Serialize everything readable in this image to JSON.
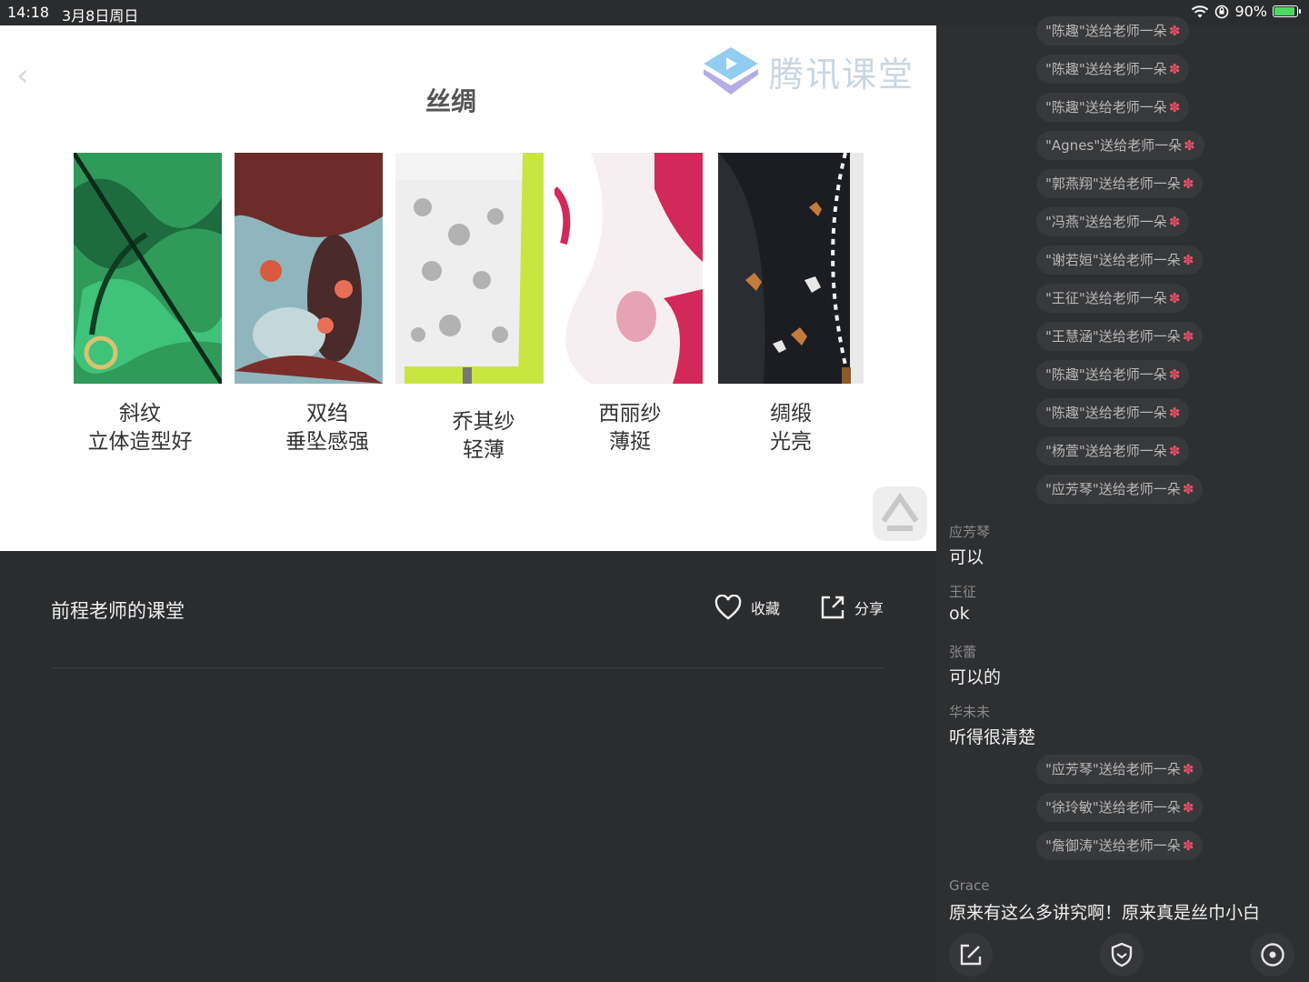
{
  "status_bar": {
    "time": "14:18",
    "date": "3月8日周日",
    "battery_percent": "90%",
    "battery_level": 0.9
  },
  "slide": {
    "title": "丝绸",
    "watermark": "腾讯课堂",
    "fabrics": [
      {
        "line1": "斜纹",
        "line2": "立体造型好"
      },
      {
        "line1": "双绉",
        "line2": "垂坠感强"
      },
      {
        "line1": "乔其纱",
        "line2": "轻薄"
      },
      {
        "line1": "西丽纱",
        "line2": "薄挺"
      },
      {
        "line1": "绸缎",
        "line2": "光亮"
      }
    ]
  },
  "course": {
    "title": "前程老师的课堂",
    "favorite_label": "收藏",
    "share_label": "分享"
  },
  "chat": {
    "gifts_top": [
      "\"陈趣\"送给老师一朵",
      "\"陈趣\"送给老师一朵",
      "\"陈趣\"送给老师一朵",
      "\"Agnes\"送给老师一朵",
      "\"郭燕翔\"送给老师一朵",
      "\"冯燕\"送给老师一朵",
      "\"谢若姮\"送给老师一朵",
      "\"王征\"送给老师一朵",
      "\"王慧涵\"送给老师一朵",
      "\"陈趣\"送给老师一朵",
      "\"陈趣\"送给老师一朵",
      "\"杨萱\"送给老师一朵",
      "\"应芳琴\"送给老师一朵"
    ],
    "messages": [
      {
        "name": "应芳琴",
        "text": "可以"
      },
      {
        "name": "王征",
        "text": "ok"
      },
      {
        "name": "张蕾",
        "text": "可以的"
      },
      {
        "name": "华未未",
        "text": "听得很清楚"
      }
    ],
    "gifts_bottom": [
      "\"应芳琴\"送给老师一朵",
      "\"徐玲敏\"送给老师一朵",
      "\"詹御涛\"送给老师一朵"
    ],
    "last_message": {
      "name": "Grace",
      "text": "原来有这么多讲究啊！原来真是丝巾小白"
    }
  }
}
